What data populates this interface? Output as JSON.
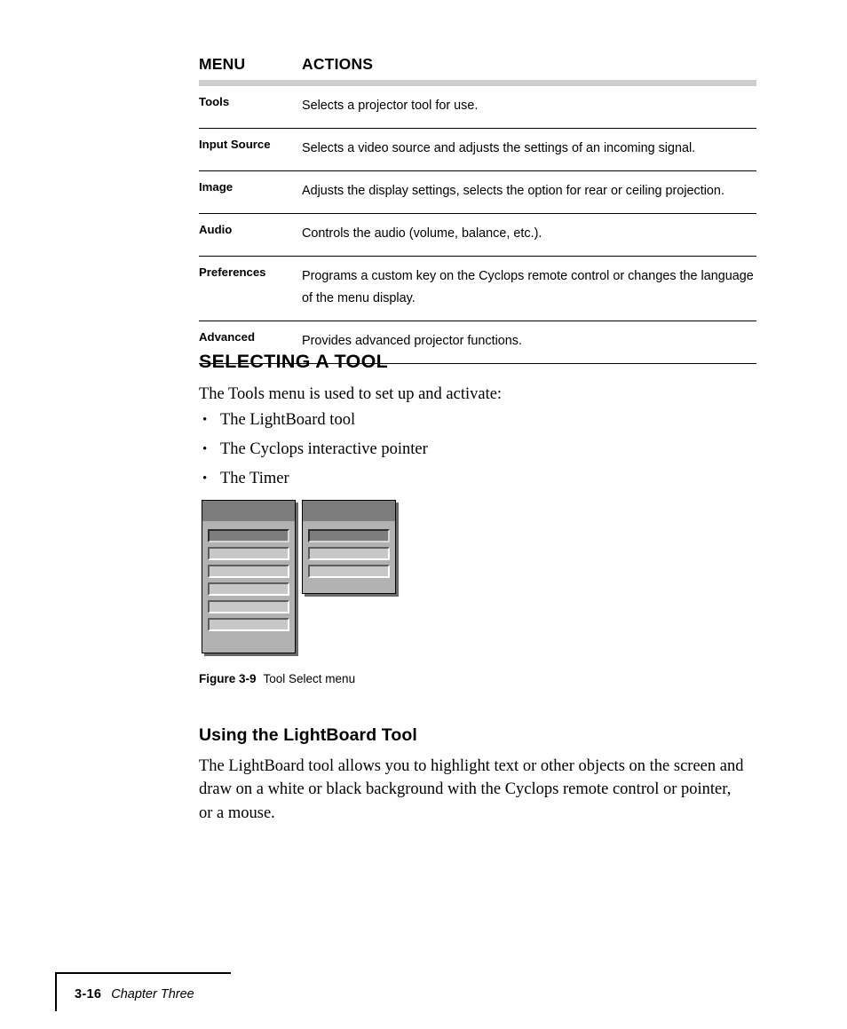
{
  "table": {
    "columns": [
      "MENU",
      "ACTIONS"
    ],
    "rows": [
      {
        "menu": "Tools",
        "action": "Selects a projector tool for use."
      },
      {
        "menu": "Input Source",
        "action": "Selects a video source and adjusts the settings of an incoming signal."
      },
      {
        "menu": "Image",
        "action": "Adjusts the display settings, selects the option for rear or ceiling projection."
      },
      {
        "menu": "Audio",
        "action": "Controls the audio (volume, balance, etc.)."
      },
      {
        "menu": "Preferences",
        "action": "Programs a custom key on the Cyclops remote control or changes the language of the menu display."
      },
      {
        "menu": "Advanced",
        "action": "Provides advanced projector functions."
      }
    ]
  },
  "section_selecting": {
    "heading": "SELECTING A TOOL",
    "intro": "The Tools menu is used to set up and activate:",
    "bullets": [
      "The LightBoard tool",
      "The Cyclops interactive pointer",
      "The Timer"
    ]
  },
  "figure": {
    "caption_label": "Figure 3-9",
    "caption_text": "Tool Select menu",
    "panels": [
      {
        "name": "tool-select-menu-panel",
        "item_count": 6,
        "selected_index": 0
      },
      {
        "name": "tool-submenu-panel",
        "item_count": 3,
        "selected_index": 0
      }
    ]
  },
  "section_lightboard": {
    "heading": "Using the LightBoard Tool",
    "paragraph": "The LightBoard tool allows you to highlight text or other objects on the screen and draw on a white or black background with the Cyclops remote control or pointer, or a mouse."
  },
  "footer": {
    "page_number": "3-16",
    "chapter": "Chapter Three"
  },
  "colors": {
    "header_bar": "#cdcdcd",
    "panel_bg": "#b2b2b2",
    "panel_title": "#7d7d7d",
    "menu_item": "#c8c8c8",
    "menu_item_selected": "#7d7d7d",
    "rule": "#000000"
  }
}
